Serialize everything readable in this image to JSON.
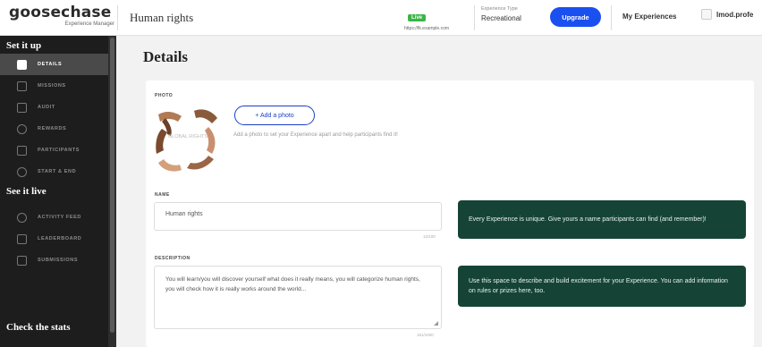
{
  "topbar": {
    "logo": "goosechase",
    "logo_sub": "Experience Manager",
    "experience_name": "Human rights",
    "status_badge": "Live",
    "status_text": "https://fk.example.com",
    "experience_type_label": "Experience Type",
    "experience_type_value": "Recreational",
    "upgrade_label": "Upgrade",
    "my_experiences": "My Experiences",
    "user_name": "lmod.profe"
  },
  "sidebar": {
    "set_it_up_title": "Set it up",
    "set_it_up_items": [
      {
        "label": "DETAILS",
        "icon": "details-icon"
      },
      {
        "label": "MISSIONS",
        "icon": "missions-icon"
      },
      {
        "label": "AUDIT",
        "icon": "audit-icon"
      },
      {
        "label": "REWARDS",
        "icon": "rewards-icon"
      },
      {
        "label": "PARTICIPANTS",
        "icon": "participants-icon"
      },
      {
        "label": "START & END",
        "icon": "clock-icon"
      }
    ],
    "see_it_live_title": "See it live",
    "see_it_live_items": [
      {
        "label": "ACTIVITY FEED",
        "icon": "activity-feed-icon"
      },
      {
        "label": "LEADERBOARD",
        "icon": "leaderboard-icon"
      },
      {
        "label": "SUBMISSIONS",
        "icon": "submissions-icon"
      }
    ],
    "stats_title": "Check the stats"
  },
  "main": {
    "page_title": "Details",
    "photo_label": "PHOTO",
    "photo_caption": "GLOBAL RIGHTS",
    "add_photo_label": "+ Add a photo",
    "photo_help": "Add a photo to set your Experience apart and help participants find it!",
    "name_label": "NAME",
    "name_value": "Human rights",
    "name_counter": "12/100",
    "name_tip": "Every Experience is unique. Give yours a name participants can find (and remember)!",
    "description_label": "DESCRIPTION",
    "description_value": "You will learn/you will discover yourself what does it really means, you will categorize human rights, you will check how it is really works around the world...",
    "description_counter": "161/1000",
    "description_tip": "Use this space to describe and build excitement for your Experience. You can add information on rules or prizes here, too."
  },
  "colors": {
    "sidebar_bg": "#1d1d1d",
    "active_nav_bg": "#4a4a4a",
    "upgrade_button": "#1a4ff0",
    "tip_bg": "#154436",
    "live_badge": "#3bb54a",
    "add_photo_outline": "#1a3fc7"
  }
}
